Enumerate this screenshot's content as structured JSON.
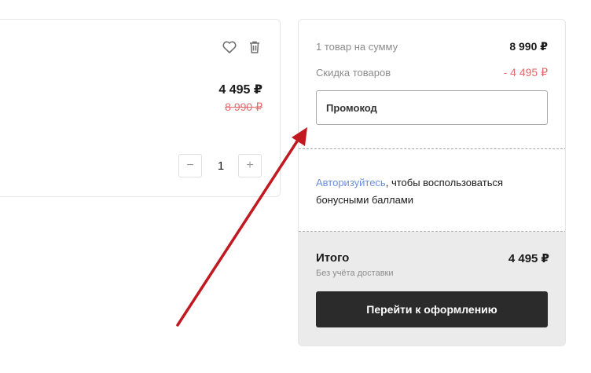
{
  "product": {
    "price_current": "4 495 ₽",
    "price_old": "8 990 ₽",
    "quantity": "1",
    "qty_minus_label": "−",
    "qty_plus_label": "+",
    "icons": [
      "heart-icon",
      "trash-icon"
    ]
  },
  "summary": {
    "items_label": "1 товар на сумму",
    "items_value": "8 990 ₽",
    "discount_label": "Скидка товаров",
    "discount_value": "- 4 495 ₽",
    "promo_placeholder": "Промокод",
    "bonus_link": "Авторизуйтесь",
    "bonus_text": ", чтобы воспользоваться бонусными баллами",
    "total_label": "Итого",
    "total_note": "Без учёта доставки",
    "total_value": "4 495 ₽",
    "checkout_label": "Перейти к оформлению"
  },
  "colors": {
    "accent_red": "#e36b6b",
    "link_blue": "#6b8fe0",
    "button_dark": "#2b2b2b",
    "annotation_arrow": "#c0191f"
  }
}
